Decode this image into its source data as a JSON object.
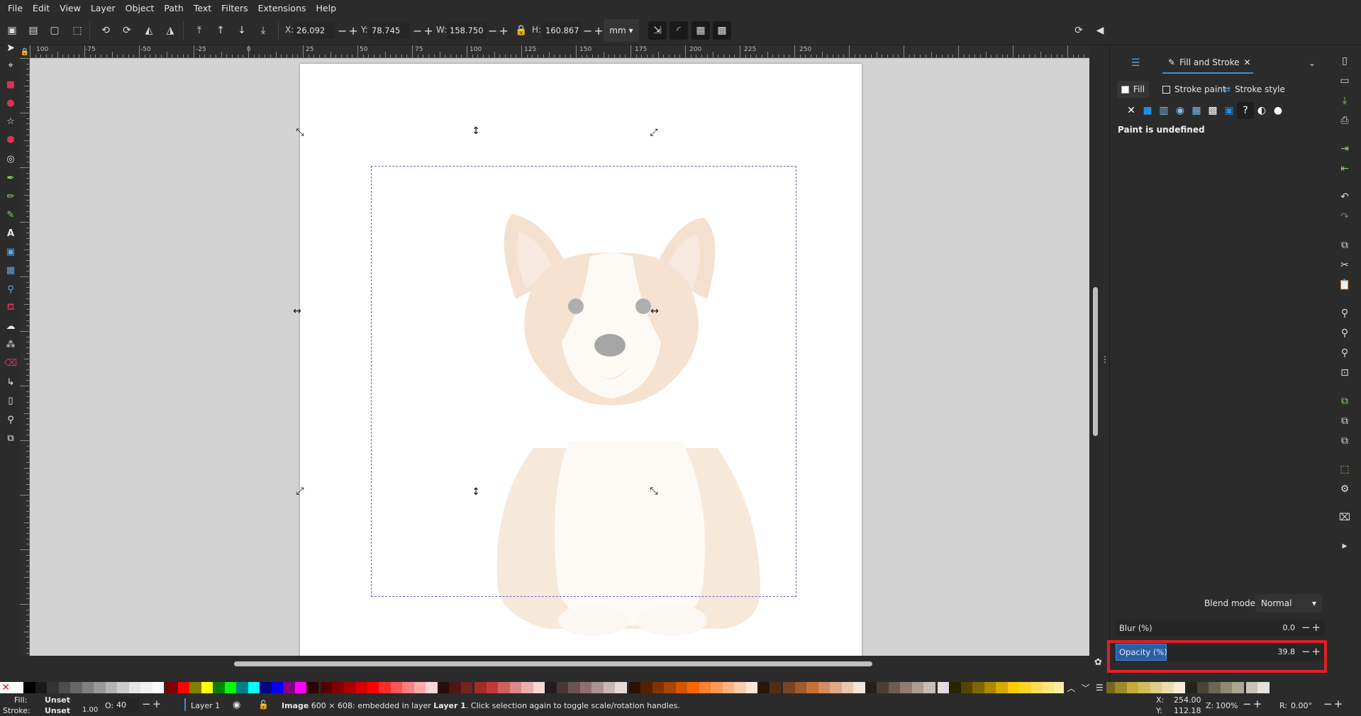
{
  "menu": [
    "File",
    "Edit",
    "View",
    "Layer",
    "Object",
    "Path",
    "Text",
    "Filters",
    "Extensions",
    "Help"
  ],
  "toolbar": {
    "x_label": "X:",
    "x_value": "26.092",
    "y_label": "Y:",
    "y_value": "78.745",
    "w_label": "W:",
    "w_value": "158.750",
    "h_label": "H:",
    "h_value": "160.867",
    "unit": "mm"
  },
  "ruler": {
    "h_labels": [
      "100",
      "-75",
      "-50",
      "-25",
      "0",
      "25",
      "50",
      "75",
      "100",
      "125",
      "150",
      "175",
      "200",
      "225",
      "250"
    ]
  },
  "dock": {
    "tab_title": "Fill and Stroke",
    "subtabs": {
      "fill": "Fill",
      "stroke_paint": "Stroke paint",
      "stroke_style": "Stroke style"
    },
    "paint_message": "Paint is undefined",
    "blend_label": "Blend mode:",
    "blend_value": "Normal",
    "blur_label": "Blur (%)",
    "blur_value": "0.0",
    "opacity_label": "Opacity (%)",
    "opacity_value": "39.8"
  },
  "status": {
    "fill_label": "Fill:",
    "fill_value": "Unset",
    "stroke_label": "Stroke:",
    "stroke_value": "Unset",
    "stroke_width": "1.00",
    "opacity_label": "O:",
    "opacity_value": "40",
    "layer": "Layer 1",
    "message_bold": "Image",
    "message_a": " 600 × 608: embedded in layer ",
    "message_layer": "Layer 1",
    "message_b": ". Click selection again to toggle scale/rotation handles.",
    "x_label": "X:",
    "x_value": "254.00",
    "y_label": "Y:",
    "y_value": "112.18",
    "zoom_label": "Z:",
    "zoom_value": "100%",
    "rotation_label": "R:",
    "rotation_value": "0.00°"
  },
  "colors": {
    "accent": "#3a8fd8",
    "highlight": "#e01f26",
    "palette": [
      "#ffffff",
      "#000000",
      "#1a1a1a",
      "#333333",
      "#4d4d4d",
      "#666666",
      "#808080",
      "#999999",
      "#b3b3b3",
      "#cccccc",
      "#e6e6e6",
      "#f2f2f2",
      "#ffffff",
      "#800000",
      "#ff0000",
      "#808000",
      "#ffff00",
      "#008000",
      "#00ff00",
      "#008080",
      "#00ffff",
      "#000080",
      "#0000ff",
      "#800080",
      "#ff00ff",
      "#2b0000",
      "#550000",
      "#800000",
      "#aa0000",
      "#d40000",
      "#ff0000",
      "#ff2a2a",
      "#ff5555",
      "#ff8080",
      "#ffaaaa",
      "#ffd5d5",
      "#280b0b",
      "#501616",
      "#782121",
      "#a02c2c",
      "#c83737",
      "#d35f5f",
      "#de8787",
      "#e9afaf",
      "#f4d7d7",
      "#241c1c",
      "#483737",
      "#6c5353",
      "#916f6f",
      "#ac9393",
      "#c8b7b7",
      "#e3dbdb",
      "#2b1100",
      "#552200",
      "#803300",
      "#aa4400",
      "#d45500",
      "#ff6600",
      "#ff7f2a",
      "#ff9955",
      "#ffb380",
      "#ffccaa",
      "#ffe6d5",
      "#28170b",
      "#502d16",
      "#784421",
      "#a05a2c",
      "#c87137",
      "#d38d5f",
      "#deaa87",
      "#e9c6af",
      "#f4e3d7",
      "#241f1c",
      "#483e37",
      "#6c5d53",
      "#917c6f",
      "#ac9d93",
      "#c8beb7",
      "#e3dedb",
      "#2b2200",
      "#554400",
      "#806600",
      "#aa8800",
      "#d4aa00",
      "#ffcc00",
      "#ffd42a",
      "#ffdd55",
      "#ffe680",
      "#ffeeaa",
      "#fff6d5",
      "#28220b",
      "#504416",
      "#786721",
      "#a0892c",
      "#c8ab37",
      "#d3bc5f",
      "#decd87",
      "#e9ddaf",
      "#f4eed7",
      "#24221c",
      "#484537",
      "#6c6753",
      "#918a6f",
      "#aca793",
      "#c8c4b7",
      "#e3e2db"
    ]
  }
}
